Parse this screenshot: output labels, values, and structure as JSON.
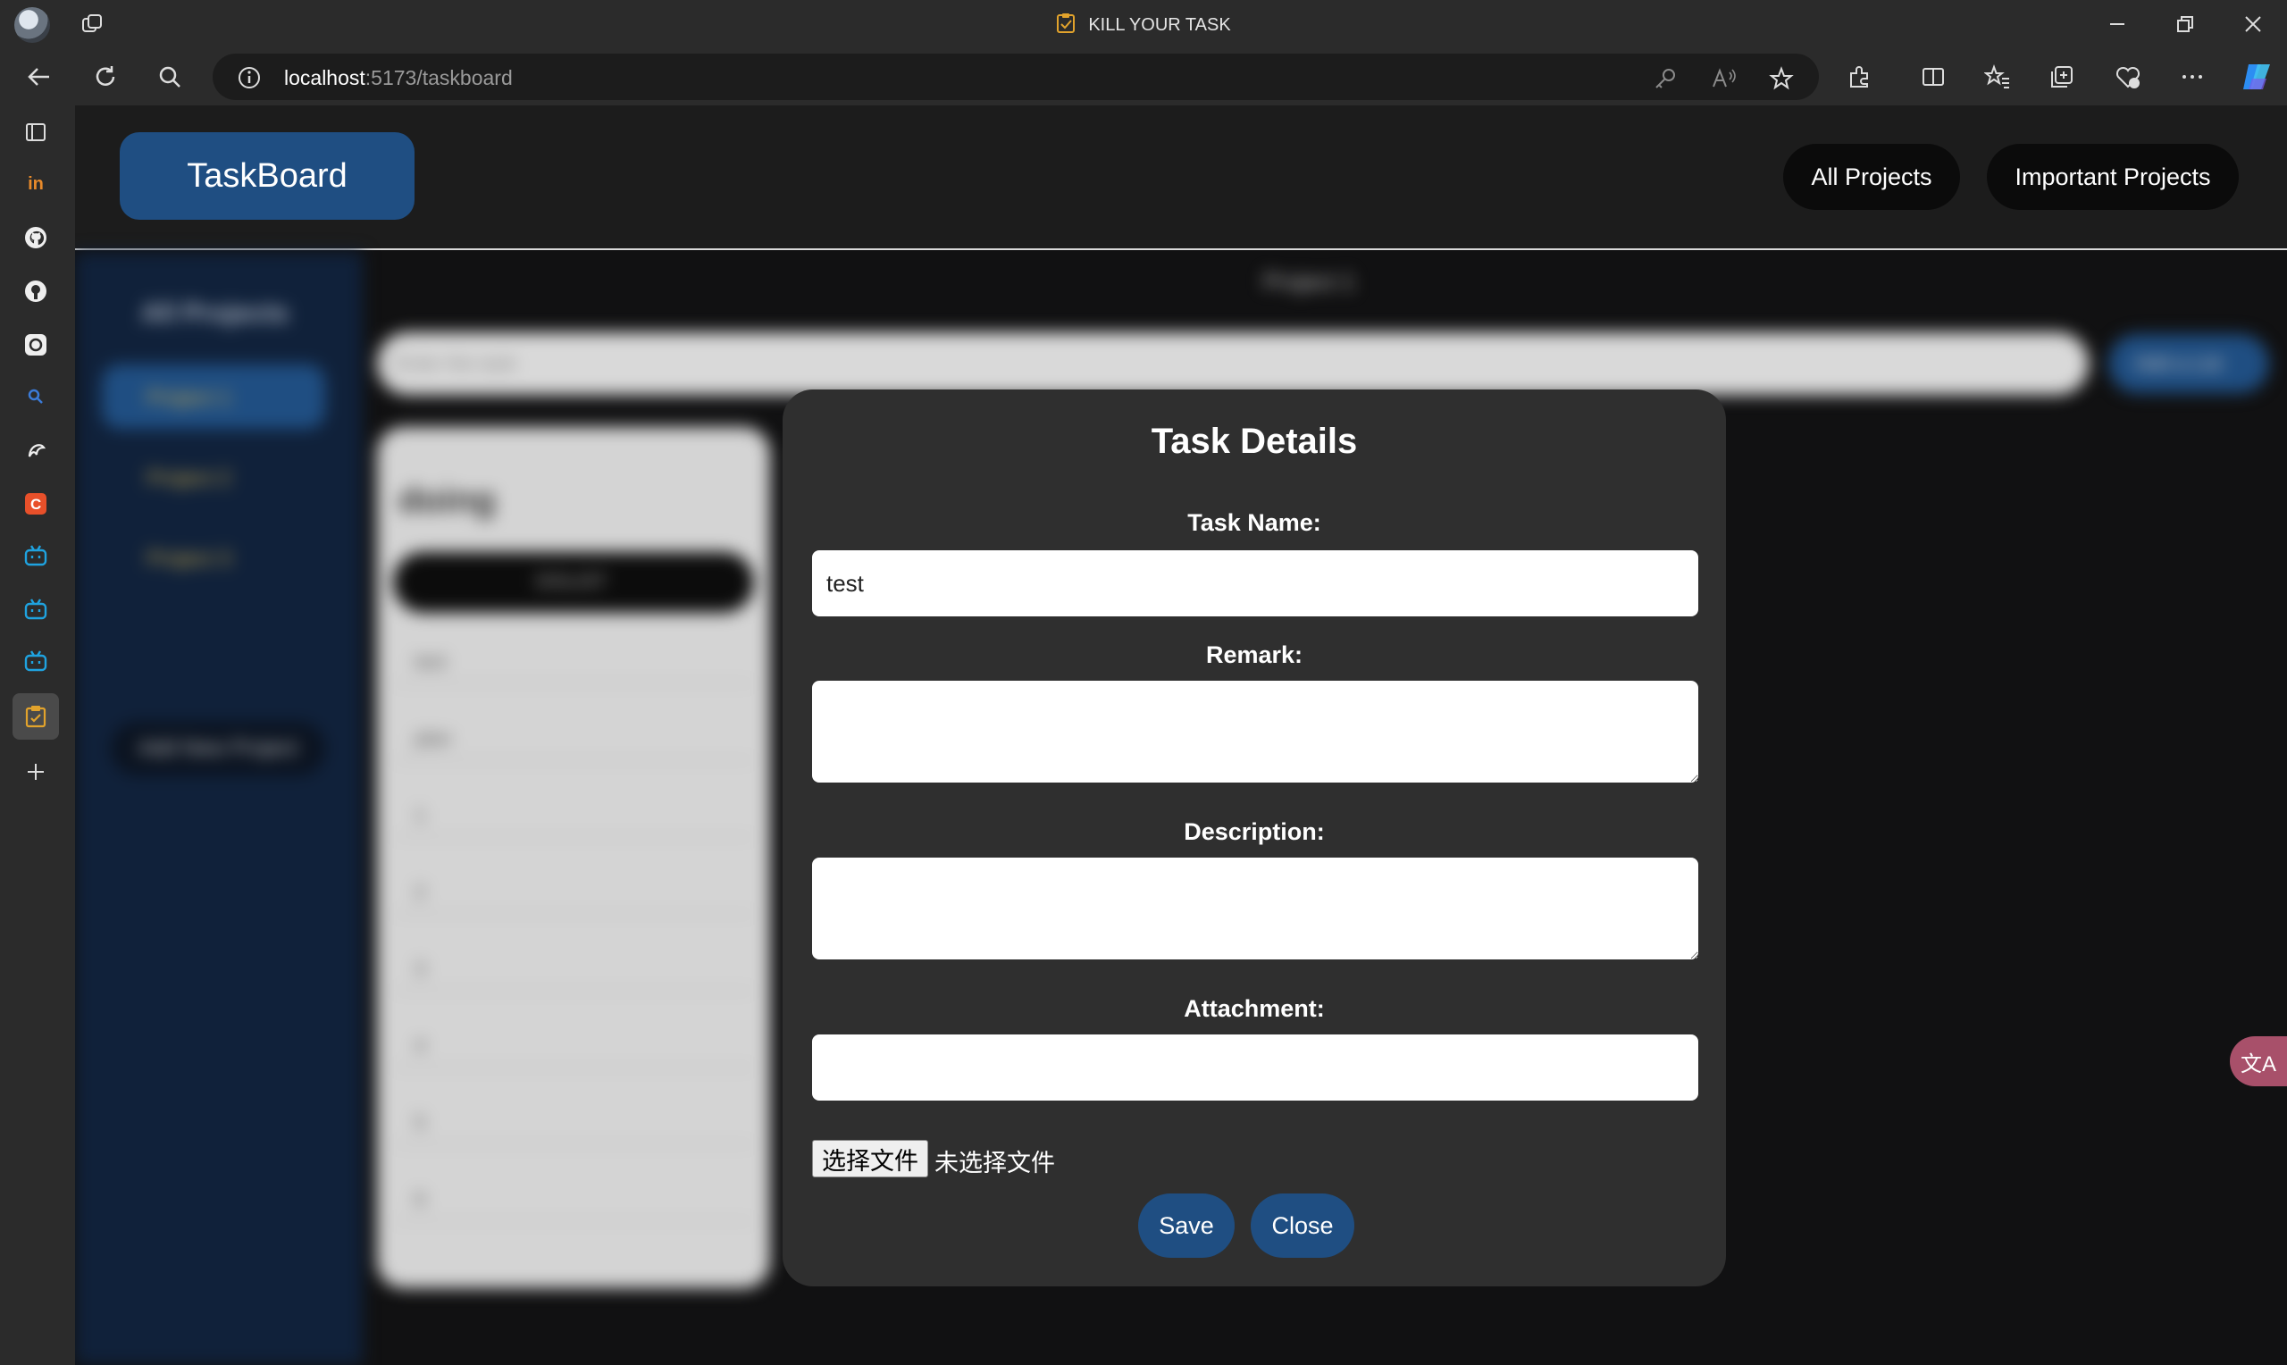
{
  "browser": {
    "tab_title": "KILL YOUR TASK",
    "url_host": "localhost",
    "url_path": ":5173/taskboard"
  },
  "header": {
    "brand": "TaskBoard",
    "nav": [
      "All Projects",
      "Important Projects"
    ]
  },
  "background": {
    "sidebar_title": "All Projects",
    "projects": [
      "Project 1",
      "Project 2",
      "Project 3"
    ],
    "add_project": "Add New Project",
    "board_title": "Project 1",
    "input_placeholder": "Enter the task",
    "add_button": "Add a List",
    "column_title": "doing",
    "column_button": "DOLIST",
    "column_rows": [
      "test",
      "plan",
      "1",
      "2",
      "3",
      "4",
      "5",
      "6"
    ]
  },
  "modal": {
    "title": "Task Details",
    "task_name_label": "Task Name:",
    "task_name_value": "test",
    "remark_label": "Remark:",
    "description_label": "Description:",
    "attachment_label": "Attachment:",
    "file_button": "选择文件",
    "file_status": "未选择文件",
    "save": "Save",
    "close": "Close"
  },
  "colors": {
    "accent": "#1f4e82",
    "modal_bg": "#2f2f2f",
    "page_bg": "#111112"
  },
  "icons": {
    "translate": "文A"
  }
}
